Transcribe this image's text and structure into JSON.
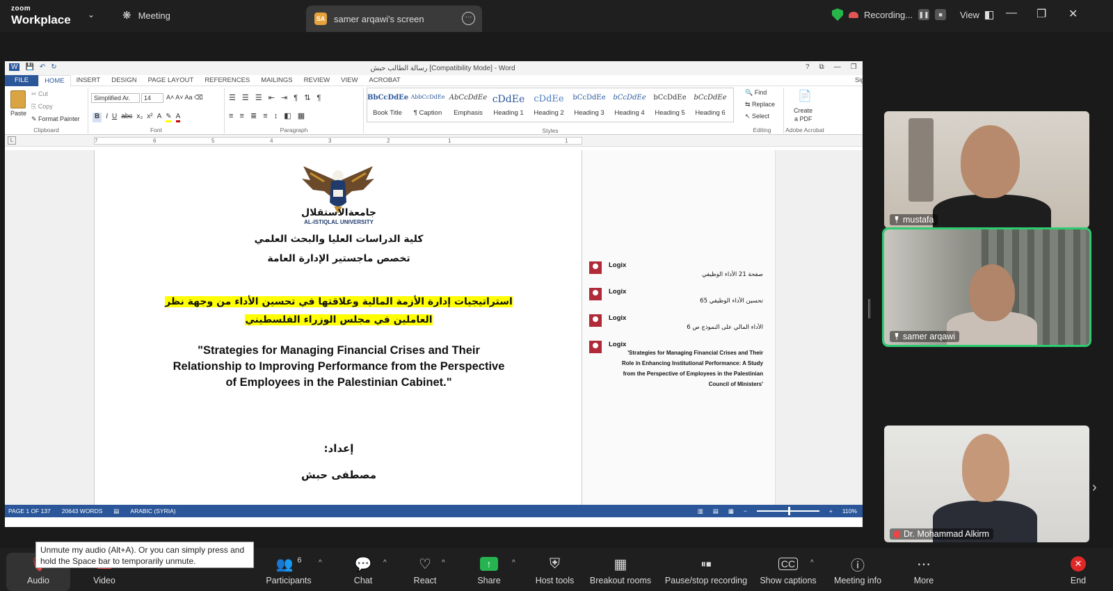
{
  "zoom": {
    "brand_small": "zoom",
    "brand_big": "Workplace",
    "meeting_tab": "Meeting",
    "screen_tab_badge": "SA",
    "screen_tab_label": "samer arqawi's screen",
    "recording_label": "Recording...",
    "view_label": "View",
    "accent": "#2ecc71"
  },
  "word": {
    "title": "رسالة الطالب حبش [Compatibility Mode] - Word",
    "title_controls": [
      "?",
      "⧉",
      "—",
      "❐",
      "✕"
    ],
    "menu": [
      "FILE",
      "HOME",
      "INSERT",
      "DESIGN",
      "PAGE LAYOUT",
      "REFERENCES",
      "MAILINGS",
      "REVIEW",
      "VIEW",
      "ACROBAT"
    ],
    "sign_in": "Sign in",
    "clipboard": {
      "paste": "Paste",
      "cut": "Cut",
      "copy": "Copy",
      "format_painter": "Format Painter",
      "label": "Clipboard"
    },
    "font": {
      "name": "Simplified Ar.",
      "size": "14",
      "label": "Font"
    },
    "paragraph_label": "Paragraph",
    "styles_label": "Styles",
    "styles": [
      {
        "preview": "BbCcDdEe",
        "name": "Book Title"
      },
      {
        "preview": "AbbCcDdEe",
        "name": "¶ Caption"
      },
      {
        "preview": "AbCcDdEe",
        "name": "Emphasis"
      },
      {
        "preview": "cDdEe",
        "name": "Heading 1"
      },
      {
        "preview": "cDdEe",
        "name": "Heading 2"
      },
      {
        "preview": "bCcDdEe",
        "name": "Heading 3"
      },
      {
        "preview": "bCcDdEe",
        "name": "Heading 4"
      },
      {
        "preview": "bCcDdEe",
        "name": "Heading 5"
      },
      {
        "preview": "bCcDdEe",
        "name": "Heading 6"
      }
    ],
    "editing": {
      "find": "Find",
      "replace": "Replace",
      "select": "Select",
      "label": "Editing"
    },
    "acrobat": {
      "create": "Create",
      "pdf": "a PDF",
      "label": "Adobe Acrobat"
    },
    "ruler_numbers": [
      "7",
      "6",
      "5",
      "4",
      "3",
      "2",
      "1",
      "1"
    ],
    "doc": {
      "university_ar": "جامعةالاستقلال",
      "university_en": "AL-ISTIQLAL UNIVERSITY",
      "faculty": "كلية الدراسات العليا والبحث العلمي",
      "program": "تخصص ماجستير الإدارة العامة",
      "title_ar_1": "استراتيجيات إدارة الأزمة المالية وعلاقتها في تحسين الأداء من وجهة نظر",
      "title_ar_2": "العاملين في مجلس الوزراء الفلسطيني",
      "title_en_1": "\"Strategies for Managing Financial Crises and Their",
      "title_en_2": "Relationship to Improving Performance from the Perspective",
      "title_en_3": "of Employees in the Palestinian Cabinet.\"",
      "prepared_by": "إعداد:",
      "author": "مصطفى حبش"
    },
    "comments": [
      {
        "author": "Logix",
        "text": "صفحة 21 الأداء الوظيفي"
      },
      {
        "author": "Logix",
        "text": "تحسين الأداء الوظيفي 65"
      },
      {
        "author": "Logix",
        "text": "الأداء المالي على النموذج ص 6"
      },
      {
        "author": "Logix",
        "text_en_1": "'Strategies for Managing Financial Crises and Their",
        "text_en_2": "Role in Enhancing Institutional Performance: A Study",
        "text_en_3": "from the Perspective of Employees in the Palestinian",
        "text_en_4": "Council of Ministers'"
      }
    ],
    "status": {
      "page": "PAGE 1 OF 137",
      "words": "20643 WORDS",
      "lang": "ARABIC (SYRIA)",
      "zoom": "110%"
    },
    "accent": "#2b579a"
  },
  "participants": [
    {
      "name": "mustafa"
    },
    {
      "name": "samer arqawi"
    },
    {
      "name": "Dr. Mohammad Alkirm"
    }
  ],
  "tooltip": "Unmute my audio (Alt+A). Or you can simply press and hold the Space bar to temporarily unmute.",
  "toolbar": {
    "audio": "Audio",
    "video": "Video",
    "participants": "Participants",
    "participants_count": "6",
    "chat": "Chat",
    "react": "React",
    "share": "Share",
    "host_tools": "Host tools",
    "breakout": "Breakout rooms",
    "pause_rec": "Pause/stop recording",
    "captions": "Show captions",
    "meeting_info": "Meeting info",
    "more": "More",
    "end": "End"
  }
}
